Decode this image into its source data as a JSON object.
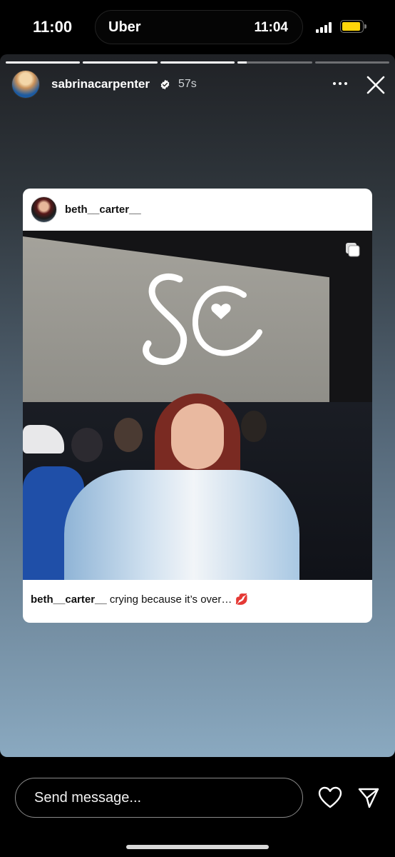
{
  "status_bar": {
    "time": "11:00",
    "live_activity": {
      "app": "Uber",
      "time": "11:04"
    },
    "battery_color": "#ffd60a"
  },
  "story": {
    "segments": [
      {
        "progress": 1.0
      },
      {
        "progress": 1.0
      },
      {
        "progress": 1.0
      },
      {
        "progress": 0.12
      },
      {
        "progress": 0.0
      }
    ],
    "header": {
      "username": "sabrinacarpenter",
      "verified_icon": "verified-badge-icon",
      "timestamp": "57s",
      "more_icon": "more-horizontal-icon",
      "close_icon": "close-icon"
    },
    "shared_post": {
      "username": "beth__carter__",
      "caption_username": "beth__carter__",
      "caption_text": "crying because it’s over… 💋",
      "multi_photo_icon": "carousel-icon"
    },
    "background_gradient": [
      "#202226",
      "#8aa9c0"
    ]
  },
  "footer": {
    "message_placeholder": "Send message...",
    "like_icon": "heart-icon",
    "send_icon": "send-icon"
  }
}
